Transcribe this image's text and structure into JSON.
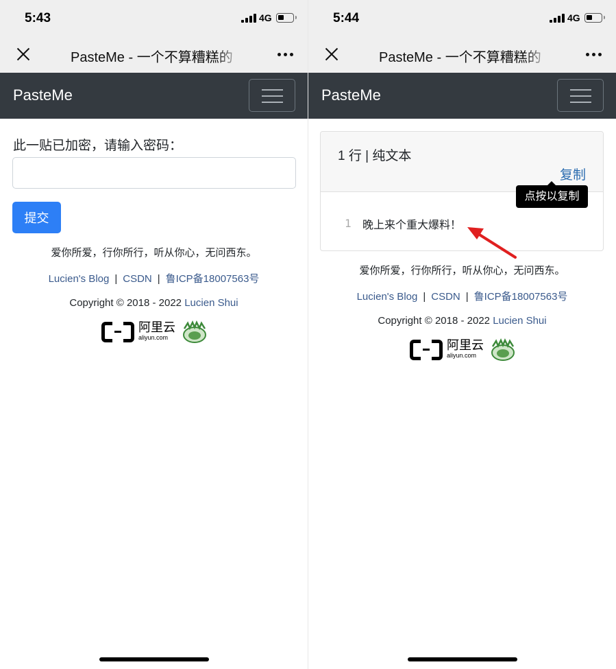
{
  "left": {
    "status": {
      "time": "5:43",
      "network": "4G"
    },
    "wechat": {
      "title": "PasteMe - 一个不算糟糕的"
    },
    "navbar": {
      "brand": "PasteMe"
    },
    "form": {
      "prompt": "此一贴已加密，请输入密码：",
      "password_value": "",
      "submit_label": "提交"
    },
    "footer": {
      "slogan": "爱你所爱，行你所行，听从你心，无问西东。",
      "links": [
        "Lucien's Blog",
        "CSDN",
        "鲁ICP备18007563号"
      ],
      "separator": "|",
      "copyright_prefix": "Copyright © 2018 - 2022",
      "copyright_author": "Lucien Shui",
      "aliyun_cn": "阿里云",
      "aliyun_en": "aliyun.com"
    }
  },
  "right": {
    "status": {
      "time": "5:44",
      "network": "4G"
    },
    "wechat": {
      "title": "PasteMe - 一个不算糟糕的"
    },
    "navbar": {
      "brand": "PasteMe"
    },
    "paste": {
      "meta": "1 行 | 纯文本",
      "copy_label": "复制",
      "tooltip": "点按以复制",
      "lines": [
        {
          "number": "1",
          "text": "晚上来个重大爆料！"
        }
      ]
    },
    "footer": {
      "slogan": "爱你所爱，行你所行，听从你心，无问西东。",
      "links": [
        "Lucien's Blog",
        "CSDN",
        "鲁ICP备18007563号"
      ],
      "separator": "|",
      "copyright_prefix": "Copyright © 2018 - 2022",
      "copyright_author": "Lucien Shui",
      "aliyun_cn": "阿里云",
      "aliyun_en": "aliyun.com"
    }
  },
  "colors": {
    "navbar": "#343a40",
    "primary_button": "#2d7ff6",
    "link": "#3a5a8c",
    "annotation_arrow": "#e02020"
  },
  "icons": [
    "close-icon",
    "more-icon",
    "menu-icon",
    "signal-icon",
    "battery-icon",
    "aliyun-logo",
    "beian-badge-icon",
    "red-arrow-annotation"
  ]
}
